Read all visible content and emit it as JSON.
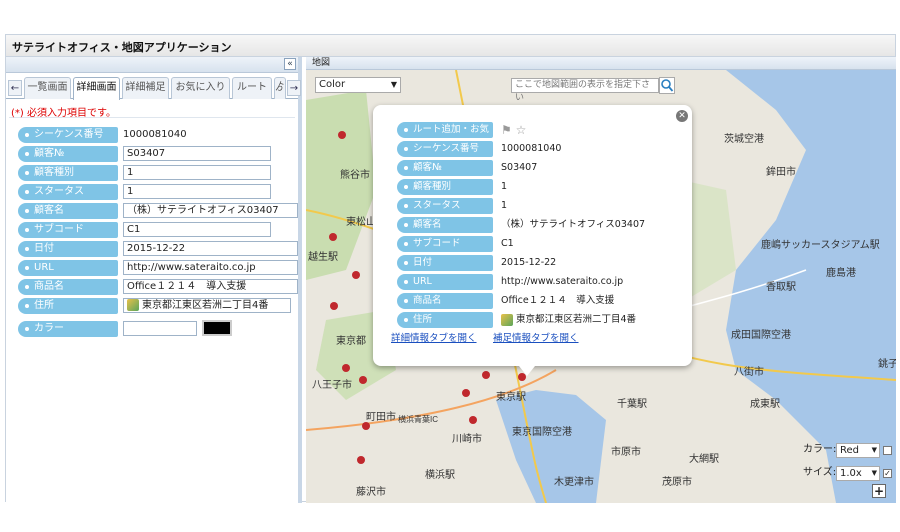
{
  "app": {
    "title": "サテライトオフィス・地図アプリケーション"
  },
  "left_panel": {
    "collapse_label": "«",
    "tabs": [
      {
        "label": "一覧画面"
      },
      {
        "label": "詳細画面"
      },
      {
        "label": "詳細補足"
      },
      {
        "label": "お気に入り"
      },
      {
        "label": "ルート"
      },
      {
        "label": "ゟ"
      }
    ],
    "required_note": "(*) 必須入力項目です。",
    "fields": [
      {
        "label": "シーケンス番号",
        "value": "1000081040"
      },
      {
        "label": "顧客№",
        "value": "S03407"
      },
      {
        "label": "顧客種別",
        "value": "1"
      },
      {
        "label": "スタータス",
        "value": "1"
      },
      {
        "label": "顧客名",
        "value": "（株）サテライトオフィス03407"
      },
      {
        "label": "サブコード",
        "value": "C1"
      },
      {
        "label": "日付",
        "value": "2015-12-22"
      },
      {
        "label": "URL",
        "value": "http://www.sateraito.co.jp"
      },
      {
        "label": "商品名",
        "value": "Office１２１４　導入支援"
      },
      {
        "label": "住所",
        "value": "東京都江東区若洲二丁目4番"
      },
      {
        "label": "カラー",
        "value": ""
      }
    ]
  },
  "map": {
    "header": "地図",
    "color_select": "Color",
    "search_placeholder": "ここで地図範囲の表示を指定下さい",
    "place_labels": [
      "熊谷市",
      "東松山",
      "越生駅",
      "東京都",
      "八王子市",
      "町田市",
      "横浜青葉IC",
      "川崎市",
      "横浜駅",
      "藤沢市",
      "茨城空港",
      "鉾田市",
      "鹿嶋サッカースタジアム駅",
      "鹿島港",
      "香取駅",
      "成田国際空港",
      "八街市",
      "千葉駅",
      "成東駅",
      "東京駅",
      "東京国際空港",
      "市原市",
      "大網駅",
      "木更津市",
      "茂原市",
      "銚子"
    ],
    "popup": {
      "rows": [
        {
          "label": "ルート追加・お気",
          "value": ""
        },
        {
          "label": "シーケンス番号",
          "value": "1000081040"
        },
        {
          "label": "顧客№",
          "value": "S03407"
        },
        {
          "label": "顧客種別",
          "value": "1"
        },
        {
          "label": "スタータス",
          "value": "1"
        },
        {
          "label": "顧客名",
          "value": "（株）サテライトオフィス03407"
        },
        {
          "label": "サブコード",
          "value": "C1"
        },
        {
          "label": "日付",
          "value": "2015-12-22"
        },
        {
          "label": "URL",
          "value": "http://www.sateraito.co.jp"
        },
        {
          "label": "商品名",
          "value": "Office１２１４　導入支援"
        },
        {
          "label": "住所",
          "value": "東京都江東区若洲二丁目4番"
        }
      ],
      "link_details": "詳細情報タブを開く",
      "link_supplement": "補足情報タブを開く"
    },
    "color_ctrl": {
      "label": "カラー:",
      "value": "Red"
    },
    "size_ctrl": {
      "label": "サイズ:",
      "value": "1.0x"
    },
    "zoom_in": "+"
  },
  "colors": {
    "label_bg": "#7fc4e6",
    "marker": "#c0282d",
    "link": "#1a4fbf",
    "required": "#dd0000"
  }
}
